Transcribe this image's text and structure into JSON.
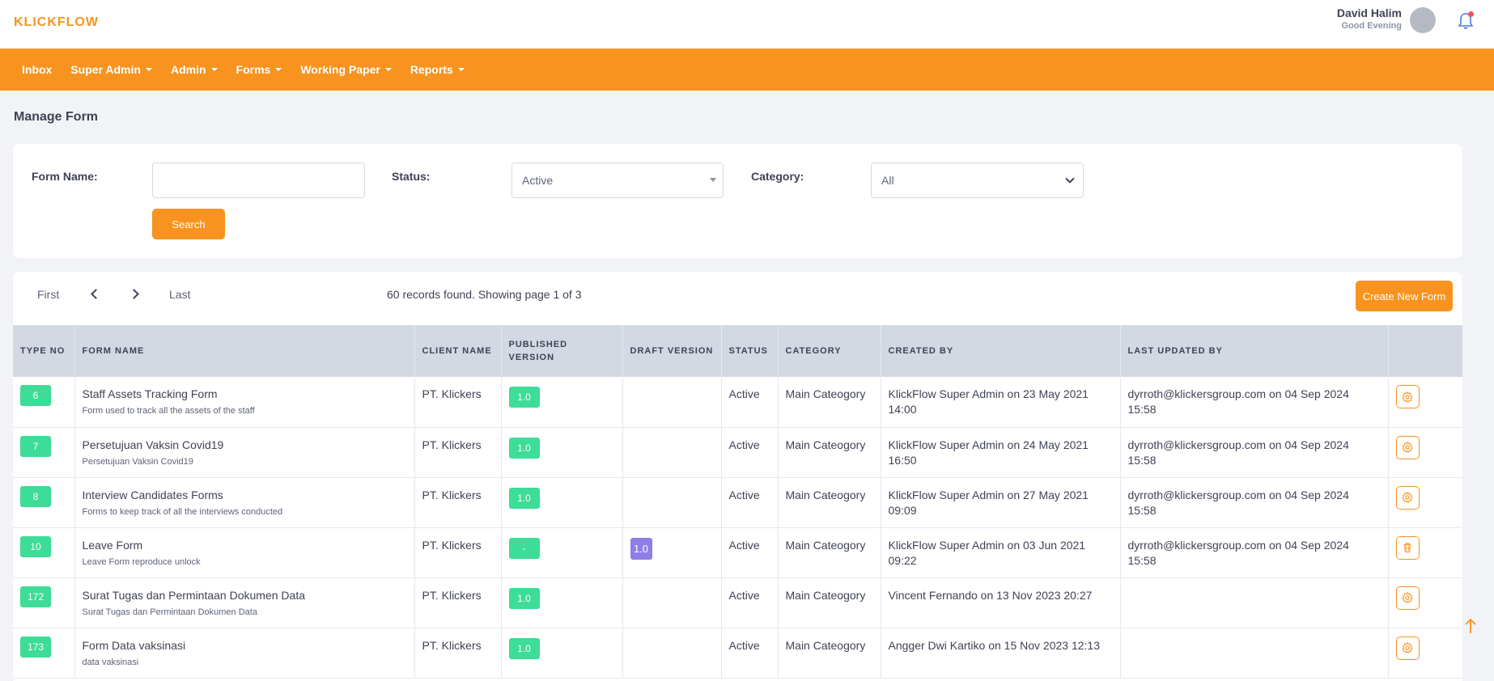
{
  "header": {
    "logo": "KLICKFLOW",
    "user_name": "David Halim",
    "greeting": "Good Evening"
  },
  "nav": [
    {
      "label": "Inbox",
      "dropdown": false
    },
    {
      "label": "Super Admin",
      "dropdown": true
    },
    {
      "label": "Admin",
      "dropdown": true
    },
    {
      "label": "Forms",
      "dropdown": true
    },
    {
      "label": "Working Paper",
      "dropdown": true
    },
    {
      "label": "Reports",
      "dropdown": true
    }
  ],
  "page_title": "Manage Form",
  "filters": {
    "form_name_label": "Form Name:",
    "form_name_value": "",
    "status_label": "Status:",
    "status_value": "Active",
    "category_label": "Category:",
    "category_value": "All",
    "search_button": "Search"
  },
  "pager": {
    "first": "First",
    "last": "Last",
    "records_text": "60 records found. Showing page 1 of 3",
    "create_button": "Create New Form"
  },
  "table": {
    "headers": [
      "TYPE NO",
      "FORM NAME",
      "CLIENT NAME",
      "PUBLISHED VERSION",
      "DRAFT VERSION",
      "STATUS",
      "CATEGORY",
      "CREATED BY",
      "LAST UPDATED BY",
      ""
    ],
    "rows": [
      {
        "type_no": "6",
        "name": "Staff Assets Tracking Form",
        "desc": "Form used to track all the assets of the staff",
        "client": "PT. Klickers",
        "published": "1.0",
        "draft": "",
        "status": "Active",
        "category": "Main Cateogory",
        "created_by": "KlickFlow Super Admin on 23 May 2021 14:00",
        "updated_by": "dyrroth@klickersgroup.com on 04 Sep 2024 15:58",
        "action_icon": "gear-icon"
      },
      {
        "type_no": "7",
        "name": "Persetujuan Vaksin Covid19",
        "desc": "Persetujuan Vaksin Covid19",
        "client": "PT. Klickers",
        "published": "1.0",
        "draft": "",
        "status": "Active",
        "category": "Main Cateogory",
        "created_by": "KlickFlow Super Admin on 24 May 2021 16:50",
        "updated_by": "dyrroth@klickersgroup.com on 04 Sep 2024 15:58",
        "action_icon": "gear-icon"
      },
      {
        "type_no": "8",
        "name": "Interview Candidates Forms",
        "desc": "Forms to keep track of all the interviews conducted",
        "client": "PT. Klickers",
        "published": "1.0",
        "draft": "",
        "status": "Active",
        "category": "Main Cateogory",
        "created_by": "KlickFlow Super Admin on 27 May 2021 09:09",
        "updated_by": "dyrroth@klickersgroup.com on 04 Sep 2024 15:58",
        "action_icon": "gear-icon"
      },
      {
        "type_no": "10",
        "name": "Leave Form",
        "desc": "Leave Form reproduce unlock",
        "client": "PT. Klickers",
        "published": "-",
        "draft": "1.0",
        "status": "Active",
        "category": "Main Cateogory",
        "created_by": "KlickFlow Super Admin on 03 Jun 2021 09:22",
        "updated_by": "dyrroth@klickersgroup.com on 04 Sep 2024 15:58",
        "action_icon": "trash-icon"
      },
      {
        "type_no": "172",
        "name": "Surat Tugas dan Permintaan Dokumen Data",
        "desc": "Surat Tugas dan Permintaan Dokumen Data",
        "client": "PT. Klickers",
        "published": "1.0",
        "draft": "",
        "status": "Active",
        "category": "Main Cateogory",
        "created_by": "Vincent Fernando on 13 Nov 2023 20:27",
        "updated_by": "",
        "action_icon": "gear-icon"
      },
      {
        "type_no": "173",
        "name": "Form Data vaksinasi",
        "desc": "data vaksinasi",
        "client": "PT. Klickers",
        "published": "1.0",
        "draft": "",
        "status": "Active",
        "category": "Main Cateogory",
        "created_by": "Angger Dwi Kartiko on 15 Nov 2023 12:13",
        "updated_by": "",
        "action_icon": "gear-icon"
      }
    ]
  },
  "colors": {
    "brand": "#f7931e",
    "badge_green": "#3ddc97",
    "badge_purple": "#8f7ee6",
    "header_bg": "#d4d8e3"
  }
}
